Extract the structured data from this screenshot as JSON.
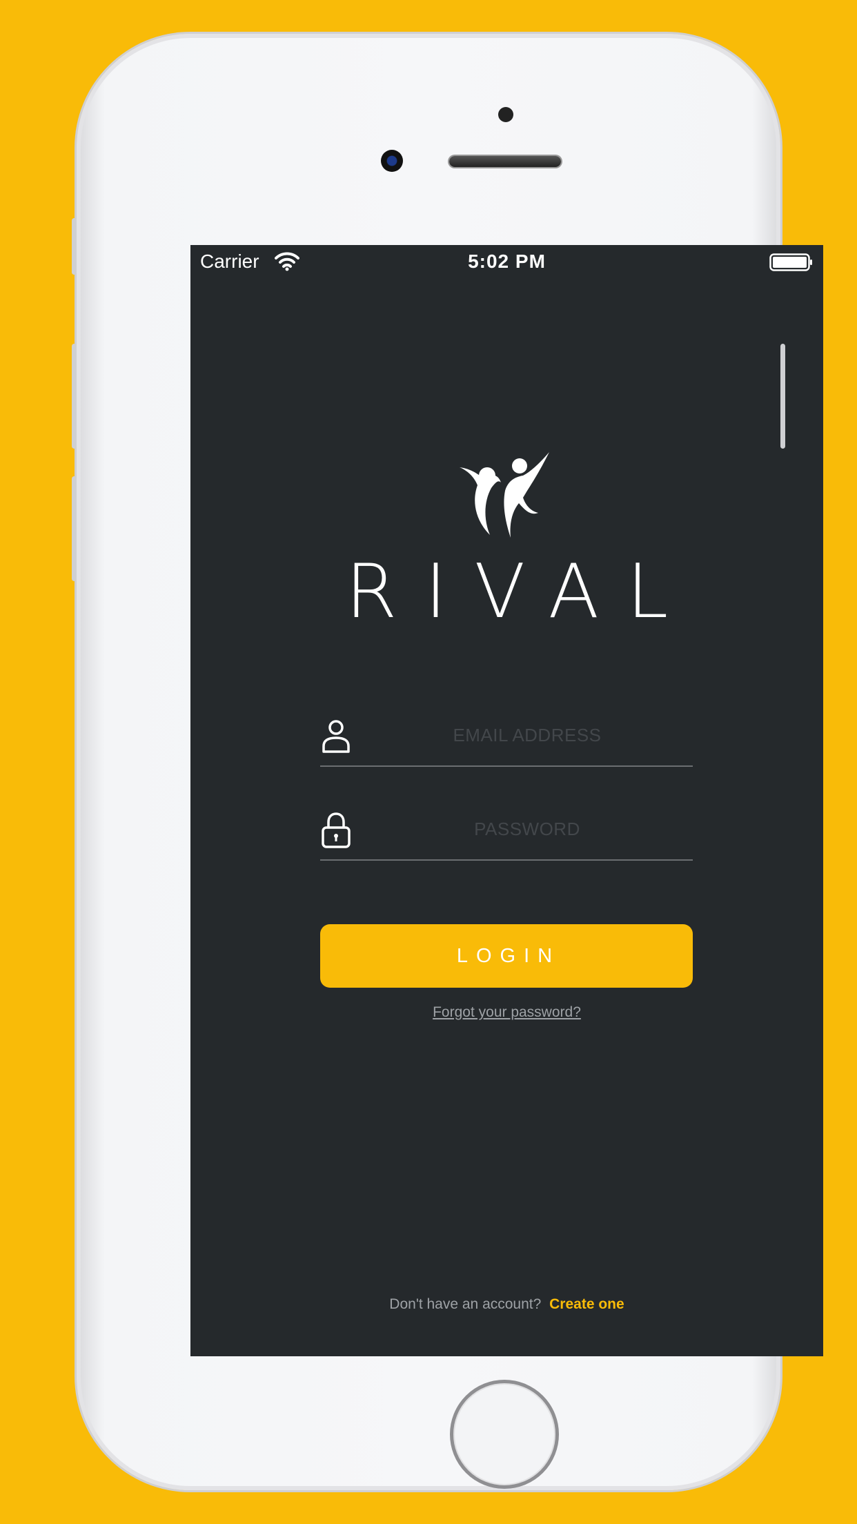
{
  "status_bar": {
    "carrier": "Carrier",
    "time": "5:02 PM"
  },
  "brand": {
    "name": "RIVAL"
  },
  "form": {
    "email_placeholder": "EMAIL ADDRESS",
    "email_value": "",
    "password_placeholder": "PASSWORD",
    "password_value": "",
    "login_label": "LOGIN",
    "forgot_label": "Forgot your password?"
  },
  "footer": {
    "prompt": "Don't have an account?",
    "link": "Create one"
  },
  "icons": [
    "wifi-icon",
    "battery-icon",
    "user-icon",
    "lock-icon",
    "rival-logo"
  ],
  "colors": {
    "accent": "#F9BB08",
    "screen_bg": "#25292C",
    "muted_text": "#9ea2a6"
  }
}
